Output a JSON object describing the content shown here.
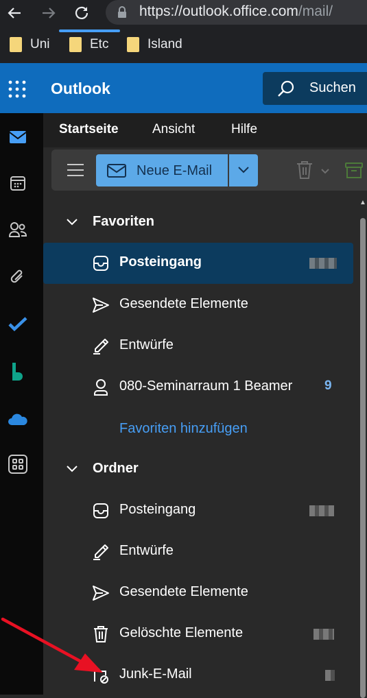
{
  "browser": {
    "url_host": "https://outlook.office.com",
    "url_path": "/mail/",
    "bookmarks": [
      "Uni",
      "Etc",
      "Island"
    ]
  },
  "app": {
    "brand": "Outlook",
    "search_label": "Suchen"
  },
  "tabs": [
    "Startseite",
    "Ansicht",
    "Hilfe"
  ],
  "ribbon": {
    "new_mail": "Neue E-Mail"
  },
  "nav": {
    "favorites_header": "Favoriten",
    "favorites": [
      {
        "label": "Posteingang",
        "icon": "inbox-icon"
      },
      {
        "label": "Gesendete Elemente",
        "icon": "send-icon"
      },
      {
        "label": "Entwürfe",
        "icon": "drafts-icon"
      },
      {
        "label": "080-Seminarraum 1 Beamer",
        "icon": "person-icon",
        "count": "9"
      }
    ],
    "add_favorite": "Favoriten hinzufügen",
    "folders_header": "Ordner",
    "folders": [
      {
        "label": "Posteingang",
        "icon": "inbox-icon"
      },
      {
        "label": "Entwürfe",
        "icon": "drafts-icon"
      },
      {
        "label": "Gesendete Elemente",
        "icon": "send-icon"
      },
      {
        "label": "Gelöschte Elemente",
        "icon": "trash-icon"
      },
      {
        "label": "Junk-E-Mail",
        "icon": "junk-icon"
      }
    ]
  },
  "colors": {
    "accent": "#0f6cbd",
    "selected": "#0c3b5e",
    "link": "#479ef5",
    "arrow": "#e81123"
  }
}
